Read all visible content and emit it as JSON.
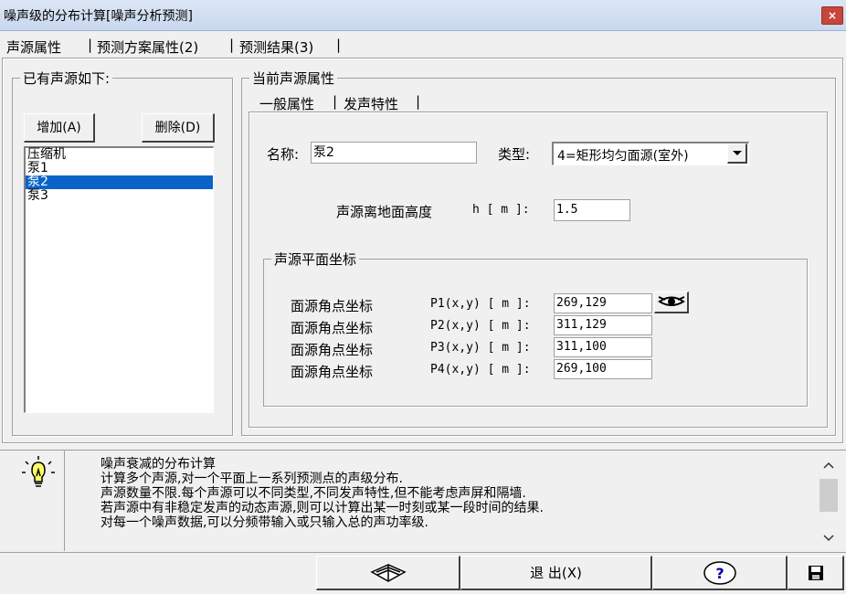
{
  "window": {
    "title": "噪声级的分布计算[噪声分析预测]",
    "close_glyph": "×"
  },
  "main_tabs": [
    {
      "label": "声源属性"
    },
    {
      "label": "预测方案属性(2)"
    },
    {
      "label": "预测结果(3)"
    }
  ],
  "tab_separator": "|",
  "source_list": {
    "legend": "已有声源如下:",
    "add_label": "增加(A)",
    "delete_label": "删除(D)",
    "items": [
      "压缩机",
      "泵1",
      "泵2",
      "泵3"
    ],
    "selected_index": 2
  },
  "current_source": {
    "legend": "当前声源属性",
    "sub_tabs": [
      {
        "label": "一般属性"
      },
      {
        "label": "发声特性"
      }
    ],
    "name_label": "名称:",
    "name_value": "泵2",
    "type_label": "类型:",
    "type_value": "4=矩形均匀面源(室外)",
    "height_label": "声源离地面高度",
    "height_symbol": "h [ m ]:",
    "height_value": "1.5",
    "coords_legend": "声源平面坐标",
    "coords": [
      {
        "label": "面源角点坐标",
        "param": "P1(x,y) [ m ]:",
        "value": "269,129"
      },
      {
        "label": "面源角点坐标",
        "param": "P2(x,y) [ m ]:",
        "value": "311,129"
      },
      {
        "label": "面源角点坐标",
        "param": "P3(x,y) [ m ]:",
        "value": "311,100"
      },
      {
        "label": "面源角点坐标",
        "param": "P4(x,y) [ m ]:",
        "value": "269,100"
      }
    ]
  },
  "info": {
    "icon": "lightbulb-icon",
    "lines": [
      "噪声衰减的分布计算",
      "计算多个声源,对一个平面上一系列预测点的声级分布.",
      "声源数量不限.每个声源可以不同类型,不同发声特性,但不能考虑声屏和隔墙.",
      "若声源中有非稳定发声的动态声源,则可以计算出某一时刻或某一段时间的结果.",
      "对每一个噪声数据,可以分频带输入或只输入总的声功率级."
    ]
  },
  "bottom": {
    "exit_label": "退 出(X)",
    "help_glyph": "?"
  }
}
